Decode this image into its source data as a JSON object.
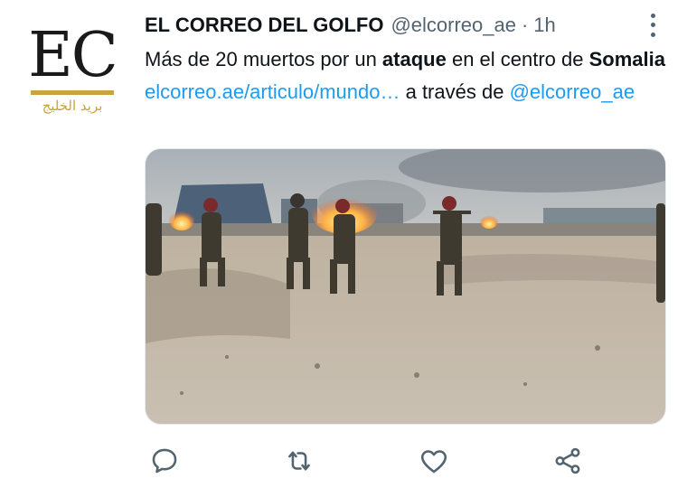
{
  "tweet": {
    "author_name": "EL CORREO DEL GOLFO",
    "author_handle": "@elcorreo_ae",
    "separator": "·",
    "time": "1h",
    "avatar": {
      "logo_text": "EC",
      "logo_subtitle": "بريد الخليج"
    },
    "text": {
      "part1": "Más de 20 muertos por un ",
      "bold1": "ataque",
      "part2": " en el centro de ",
      "bold2": "Somalia",
      "link": "elcorreo.ae/articulo/mundo…",
      "part3": " a través de ",
      "mention": "@elcorreo_ae"
    },
    "media": {
      "icon": "video-thumbnail"
    }
  },
  "actions": [
    {
      "icon": "reply-icon"
    },
    {
      "icon": "retweet-icon"
    },
    {
      "icon": "like-icon"
    },
    {
      "icon": "share-icon"
    }
  ],
  "colors": {
    "link": "#1d9bf0",
    "secondary": "#536471",
    "logo_gold": "#c8a53c"
  }
}
